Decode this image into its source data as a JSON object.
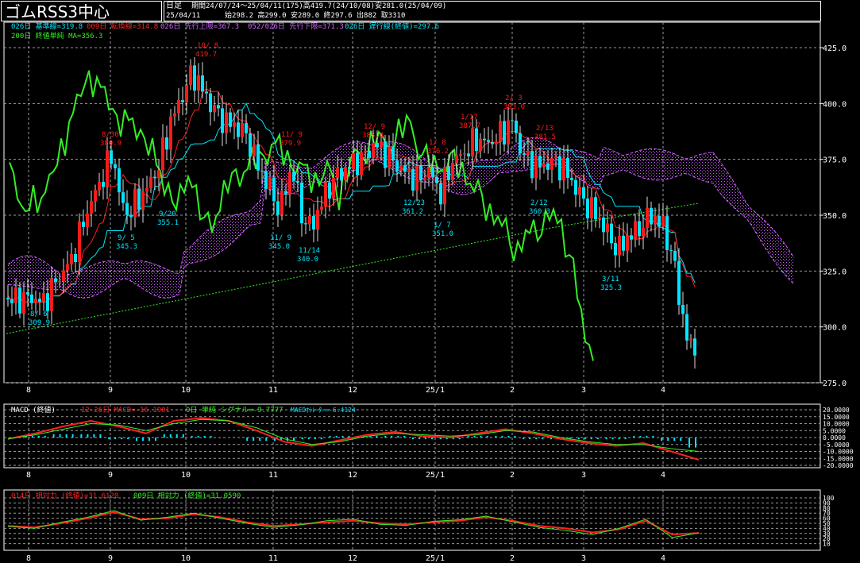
{
  "header": {
    "title": "ゴムRSS3中心",
    "timeframe": "日足",
    "period": "期間24/07/24～25/04/11(175)高419.7(24/10/08)安281.0(25/04/09)",
    "date": "25/04/11",
    "ohlc": "始298.2 高299.0 安289.0 終297.6 出882 取3310"
  },
  "legend": {
    "kijun": "026日 基準線=319.8",
    "tenkan": "009日 転換線=314.8",
    "senkou_a": "026日 先行上限=367.3",
    "senkou_b": "052/026日 先行下限=371.3",
    "chikou": "026日 遅行線(終値)=297.6",
    "ma200": "200日 終値単純 MA=356.3"
  },
  "macd_legend": {
    "title": "MACD (終値)",
    "macd": "12-26日 MACD=-16.1901",
    "signal": "9日 単純 シグナル=-9.7777",
    "osc": "MACDｵｼﾚｰﾀｰ=-6.4124"
  },
  "rsi_legend": {
    "rsi14": "014日 相対力 (終値)=31.6120",
    "rsi9": "009日 相対力 (終値)=31.0590"
  },
  "colors": {
    "background": "#000000",
    "grid": "#9a9a9a",
    "up_candle": "#ff1a1a",
    "down_candle": "#00e5ff",
    "kijun": "#00e5ff",
    "tenkan": "#ff2020",
    "chikou": "#33ee22",
    "ma200": "#33ee22",
    "kumo": "#d060ff",
    "macd": "#ff2020",
    "signal": "#33ee22",
    "osc": "#00e5ff"
  },
  "chart_data": [
    {
      "type": "candlestick",
      "title": "ゴムRSS3中心",
      "ylim": [
        275,
        425
      ],
      "yticks": [
        "275.0",
        "300.0",
        "325.0",
        "350.0",
        "375.0",
        "400.0",
        "425.0"
      ],
      "xticks": [
        "8",
        "9",
        "10",
        "11",
        "12",
        "25/1",
        "2",
        "3",
        "4"
      ],
      "grid": true,
      "annotations": [
        {
          "date": "8/ 6",
          "value": "309.9",
          "kind": "low"
        },
        {
          "date": "8/30",
          "value": "380.9",
          "kind": "high"
        },
        {
          "date": "9/ 5",
          "value": "345.3",
          "kind": "low"
        },
        {
          "date": "9/20",
          "value": "355.1",
          "kind": "low"
        },
        {
          "date": "10/ 8",
          "value": "419.7",
          "kind": "high"
        },
        {
          "date": "11/ 9",
          "value": "345.0",
          "kind": "low"
        },
        {
          "date": "11/ 9",
          "value": "379.9",
          "kind": "high"
        },
        {
          "date": "11/14",
          "value": "340.0",
          "kind": "low"
        },
        {
          "date": "12/ 9",
          "value": "383.4",
          "kind": "high"
        },
        {
          "date": "12/23",
          "value": "361.2",
          "kind": "low"
        },
        {
          "date": "1/ 8",
          "value": "376.2",
          "kind": "high"
        },
        {
          "date": "1/ 7",
          "value": "351.0",
          "kind": "low"
        },
        {
          "date": "1/17",
          "value": "387.7",
          "kind": "high"
        },
        {
          "date": "2/ 3",
          "value": "393.0",
          "kind": "high"
        },
        {
          "date": "2/13",
          "value": "381.5",
          "kind": "high"
        },
        {
          "date": "2/12",
          "value": "360.3",
          "kind": "low"
        },
        {
          "date": "3/11",
          "value": "325.3",
          "kind": "low"
        }
      ]
    },
    {
      "type": "line",
      "title": "MACD (終値)",
      "ylim": [
        -20,
        20
      ],
      "yticks": [
        "20.0000",
        "15.0000",
        "10.0000",
        "5.0000",
        "0.0000",
        "-5.0000",
        "-10.0000",
        "-15.0000",
        "-20.0000"
      ],
      "series": [
        {
          "name": "MACD",
          "values": [
            -1,
            3,
            8,
            12,
            8,
            3,
            12,
            14,
            12,
            5,
            -3,
            -6,
            -2,
            2,
            4,
            1,
            0,
            3,
            6,
            3,
            -1,
            -4,
            -6,
            -4,
            -10,
            -16
          ]
        },
        {
          "name": "シグナル",
          "values": [
            -1,
            2,
            6,
            10,
            9,
            5,
            10,
            13,
            12,
            7,
            -1,
            -5,
            -3,
            1,
            3,
            2,
            1,
            2,
            5,
            4,
            0,
            -3,
            -5,
            -5,
            -8,
            -10
          ]
        }
      ]
    },
    {
      "type": "line",
      "title": "相対力",
      "ylim": [
        0,
        100
      ],
      "yticks": [
        "100",
        "90",
        "80",
        "70",
        "60",
        "50",
        "40",
        "30",
        "20",
        "10"
      ],
      "series": [
        {
          "name": "014日 相対力",
          "values": [
            45,
            42,
            50,
            60,
            72,
            58,
            60,
            68,
            62,
            52,
            45,
            48,
            52,
            55,
            50,
            48,
            52,
            55,
            62,
            55,
            45,
            40,
            32,
            38,
            55,
            28,
            31
          ]
        },
        {
          "name": "009日 相対力",
          "values": [
            44,
            40,
            52,
            62,
            75,
            56,
            62,
            70,
            60,
            50,
            42,
            47,
            55,
            58,
            48,
            46,
            54,
            57,
            64,
            53,
            42,
            36,
            28,
            40,
            58,
            22,
            31
          ]
        }
      ]
    }
  ]
}
